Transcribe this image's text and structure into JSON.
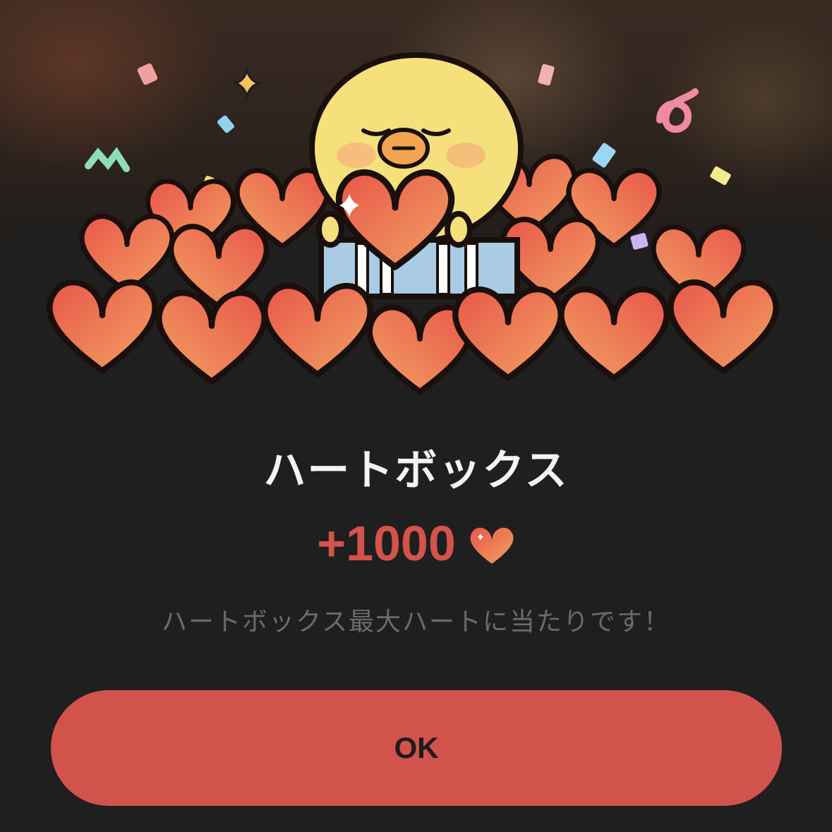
{
  "dialog": {
    "title": "ハートボックス",
    "reward_amount": "+1000",
    "reward_icon": "heart-icon",
    "message": "ハートボックス最大ハートに当たりです！",
    "ok_label": "OK"
  },
  "colors": {
    "accent": "#d2534b",
    "reward_text": "#d4534b",
    "sheet_background": "#1f1f1f",
    "title_text": "#f4f4f4",
    "message_text": "#6b6b6b",
    "button_text": "#1c1c1c"
  },
  "illustration": {
    "subject": "chick-with-heart-box",
    "decorations": [
      "confetti",
      "sparkle-icon",
      "heart-pile"
    ]
  }
}
